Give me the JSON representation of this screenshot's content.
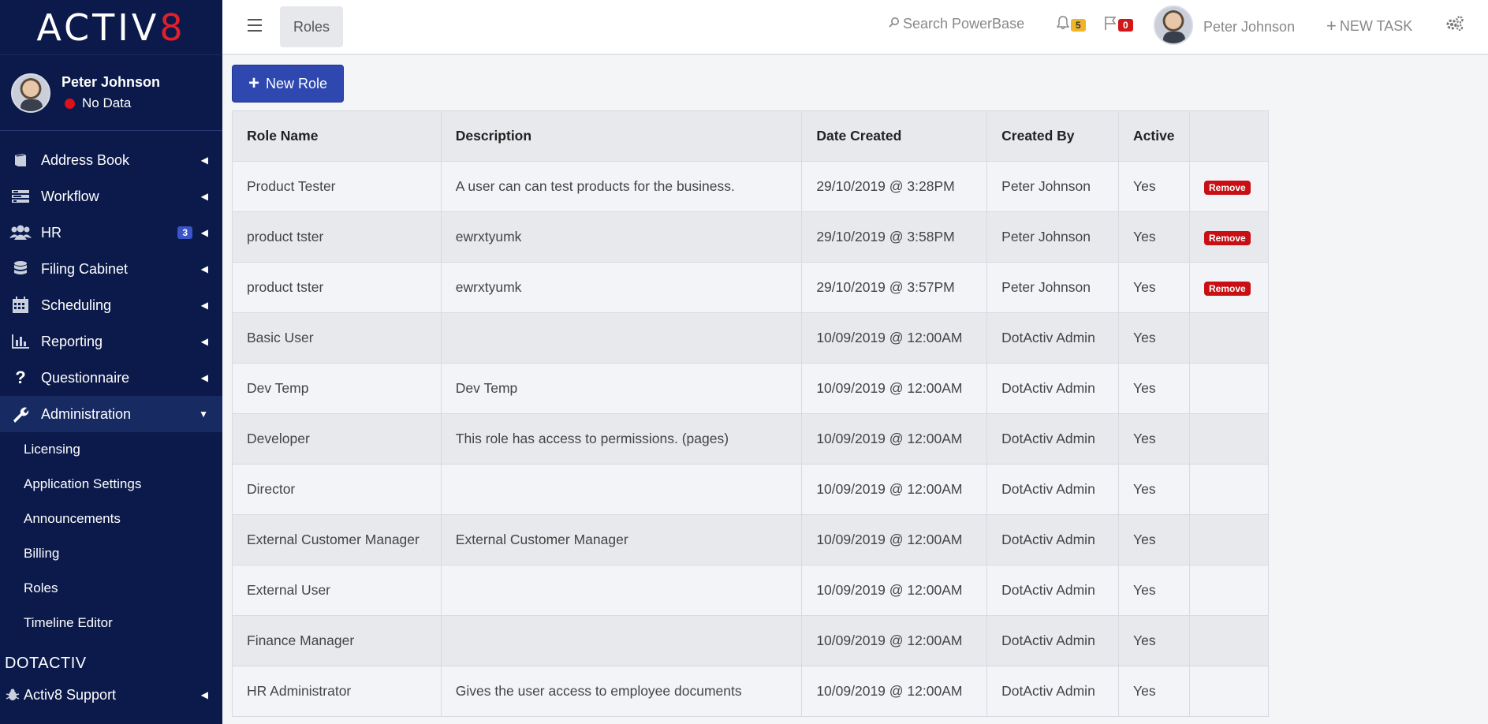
{
  "brand": {
    "text": "ACTIV",
    "suffix": "8"
  },
  "profile": {
    "name": "Peter Johnson",
    "status": "No Data"
  },
  "sidebar": {
    "items": [
      {
        "label": "Address Book",
        "icon": "book-icon"
      },
      {
        "label": "Workflow",
        "icon": "workflow-icon"
      },
      {
        "label": "HR",
        "icon": "users-icon",
        "badge": "3"
      },
      {
        "label": "Filing Cabinet",
        "icon": "database-icon"
      },
      {
        "label": "Scheduling",
        "icon": "calendar-icon"
      },
      {
        "label": "Reporting",
        "icon": "bar-chart-icon"
      },
      {
        "label": "Questionnaire",
        "icon": "question-icon"
      },
      {
        "label": "Administration",
        "icon": "wrench-icon",
        "expanded": true
      }
    ],
    "subitems": [
      "Licensing",
      "Application Settings",
      "Announcements",
      "Billing",
      "Roles",
      "Timeline Editor"
    ],
    "section_title": "DOTACTIV",
    "support_label": "Activ8 Support"
  },
  "topbar": {
    "page": "Roles",
    "search_placeholder": "Search PowerBase",
    "notifications_count": "5",
    "flags_count": "0",
    "user_name": "Peter Johnson",
    "new_task_label": "NEW TASK"
  },
  "main": {
    "new_role_label": "New Role",
    "columns": [
      "Role Name",
      "Description",
      "Date Created",
      "Created By",
      "Active",
      ""
    ],
    "rows": [
      {
        "name": "Product Tester",
        "desc": "A user can can test products for the business.",
        "date": "29/10/2019 @ 3:28PM",
        "by": "Peter Johnson",
        "active": "Yes",
        "remove": "Remove"
      },
      {
        "name": "product tster",
        "desc": "ewrxtyumk",
        "date": "29/10/2019 @ 3:58PM",
        "by": "Peter Johnson",
        "active": "Yes",
        "remove": "Remove"
      },
      {
        "name": "product tster",
        "desc": "ewrxtyumk",
        "date": "29/10/2019 @ 3:57PM",
        "by": "Peter Johnson",
        "active": "Yes",
        "remove": "Remove"
      },
      {
        "name": "Basic User",
        "desc": "",
        "date": "10/09/2019 @ 12:00AM",
        "by": "DotActiv Admin",
        "active": "Yes",
        "remove": ""
      },
      {
        "name": "Dev Temp",
        "desc": "Dev Temp",
        "date": "10/09/2019 @ 12:00AM",
        "by": "DotActiv Admin",
        "active": "Yes",
        "remove": ""
      },
      {
        "name": "Developer",
        "desc": "This role has access to permissions. (pages)",
        "date": "10/09/2019 @ 12:00AM",
        "by": "DotActiv Admin",
        "active": "Yes",
        "remove": ""
      },
      {
        "name": "Director",
        "desc": "",
        "date": "10/09/2019 @ 12:00AM",
        "by": "DotActiv Admin",
        "active": "Yes",
        "remove": ""
      },
      {
        "name": "External Customer Manager",
        "desc": "External Customer Manager",
        "date": "10/09/2019 @ 12:00AM",
        "by": "DotActiv Admin",
        "active": "Yes",
        "remove": ""
      },
      {
        "name": "External User",
        "desc": "",
        "date": "10/09/2019 @ 12:00AM",
        "by": "DotActiv Admin",
        "active": "Yes",
        "remove": ""
      },
      {
        "name": "Finance Manager",
        "desc": "",
        "date": "10/09/2019 @ 12:00AM",
        "by": "DotActiv Admin",
        "active": "Yes",
        "remove": ""
      },
      {
        "name": "HR Administrator",
        "desc": "Gives the user access to employee documents",
        "date": "10/09/2019 @ 12:00AM",
        "by": "DotActiv Admin",
        "active": "Yes",
        "remove": ""
      }
    ]
  },
  "colors": {
    "sidebar_bg": "#0b1a4a",
    "primary": "#2e48b0",
    "danger": "#c80f14",
    "warning": "#f0b429"
  }
}
